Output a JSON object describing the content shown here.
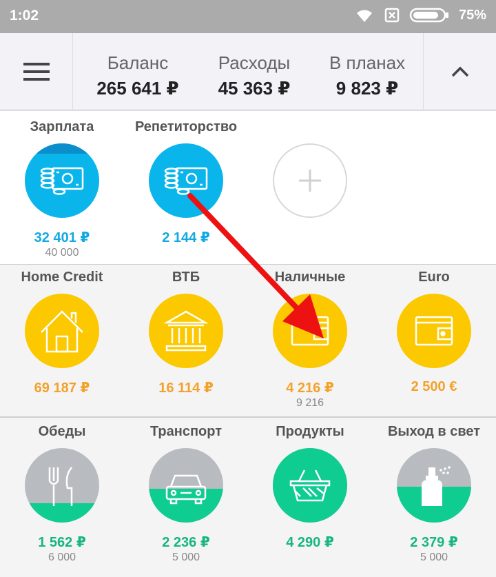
{
  "status": {
    "time": "1:02",
    "battery": "75%"
  },
  "header": {
    "balance_label": "Баланс",
    "balance_value": "265 641 ₽",
    "expenses_label": "Расходы",
    "expenses_value": "45 363 ₽",
    "planned_label": "В планах",
    "planned_value": "9 823 ₽"
  },
  "income": [
    {
      "name": "Зарплата",
      "value": "32 401 ₽",
      "sub": "40 000",
      "icon": "money-icon"
    },
    {
      "name": "Репетиторство",
      "value": "2 144 ₽",
      "sub": "",
      "icon": "money-icon"
    }
  ],
  "accounts": [
    {
      "name": "Home Credit",
      "value": "69 187 ₽",
      "sub": "",
      "icon": "house-icon"
    },
    {
      "name": "ВТБ",
      "value": "16 114 ₽",
      "sub": "",
      "icon": "bank-icon"
    },
    {
      "name": "Наличные",
      "value": "4 216 ₽",
      "sub": "9 216",
      "icon": "wallet-icon"
    },
    {
      "name": "Euro",
      "value": "2 500 €",
      "sub": "",
      "icon": "wallet-icon"
    }
  ],
  "expenses": [
    {
      "name": "Обеды",
      "value": "1 562 ₽",
      "sub": "6 000",
      "icon": "cutlery-icon",
      "fill": 0.26
    },
    {
      "name": "Транспорт",
      "value": "2 236 ₽",
      "sub": "5 000",
      "icon": "car-icon",
      "fill": 0.45
    },
    {
      "name": "Продукты",
      "value": "4 290 ₽",
      "sub": "",
      "icon": "basket-icon",
      "fill": 1.0
    },
    {
      "name": "Выход в свет",
      "value": "2 379 ₽",
      "sub": "5 000",
      "icon": "perfume-icon",
      "fill": 0.48
    }
  ],
  "colors": {
    "income": "#0ab5ec",
    "accounts": "#fcc800",
    "expenses": "#0fcc91",
    "arrow": "#ee1111"
  }
}
